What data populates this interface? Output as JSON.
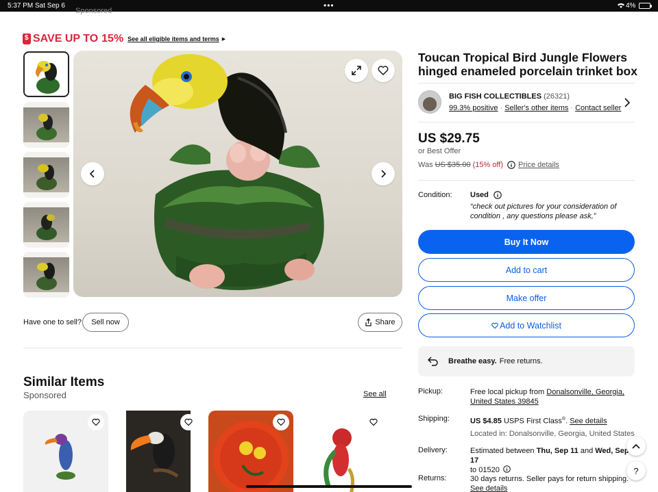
{
  "status_bar": {
    "time": "5:37 PM",
    "date": "Sat Sep 6",
    "battery": "4%"
  },
  "sponsored_top": "Sponsored",
  "promo": {
    "save": "SAVE UP TO",
    "percent": "15%",
    "link": "See all eligible items and terms"
  },
  "product": {
    "title": "Toucan Tropical Bird Jungle Flowers hinged enameled porcelain trinket box",
    "price": "US $29.75",
    "best_offer": "or Best Offer",
    "was_label": "Was",
    "was_price": "US $35.00",
    "discount": "(15% off)",
    "price_details": "Price details"
  },
  "seller": {
    "name": "BIG FISH COLLECTIBLES",
    "count": "(26321)",
    "positive": "99.3% positive",
    "other_items": "Seller's other items",
    "contact": "Contact seller"
  },
  "condition": {
    "label": "Condition:",
    "value": "Used",
    "note": "“check out pictures for your consideration of condition , any questions please ask,”"
  },
  "buttons": {
    "buy": "Buy It Now",
    "cart": "Add to cart",
    "offer": "Make offer",
    "watch": "Add to Watchlist",
    "sell_now": "Sell now",
    "share": "Share"
  },
  "returns_banner": {
    "bold": "Breathe easy.",
    "text": "Free returns."
  },
  "pickup": {
    "label": "Pickup:",
    "text": "Free local pickup from",
    "place_line1": "Donalsonville, Georgia,",
    "place_line2": "United States 39845"
  },
  "shipping": {
    "label": "Shipping:",
    "cost": "US $4.85",
    "service": "USPS First Class",
    "reg": "®",
    "see_details": "See details",
    "located": "Located in: Donalsonville, Georgia, United States"
  },
  "delivery": {
    "label": "Delivery:",
    "text": "Estimated between",
    "from": "Thu, Sep 11",
    "and": "and",
    "to": "Wed, Sep 17",
    "zip": "to 01520"
  },
  "returns": {
    "label": "Returns:",
    "text": "30 days returns. Seller pays for return shipping.",
    "see_details": "See details"
  },
  "sell_prompt": "Have one to sell?",
  "similar": {
    "title": "Similar Items",
    "sponsored": "Sponsored",
    "see_all": "See all"
  },
  "colors": {
    "accent_blue": "#0a63f0",
    "sale_red": "#d9263a"
  }
}
